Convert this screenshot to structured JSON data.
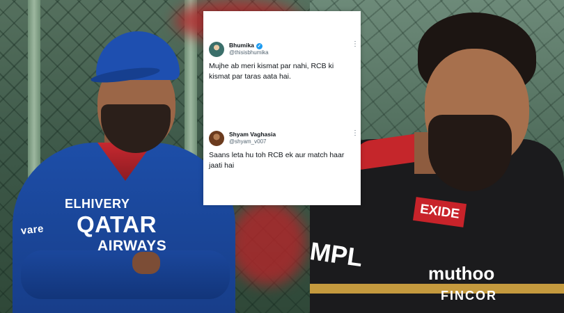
{
  "left_photo": {
    "jersey_sponsor": "ELHIVERY",
    "jersey_main_1": "QATAR",
    "jersey_main_2": "AIRWAYS",
    "sleeve_text": "vare"
  },
  "right_photo": {
    "chest_badge": "EXIDE",
    "sleeve_text": "MPL",
    "sponsor_1": "muthoo",
    "sponsor_2": "FINCOR"
  },
  "tweets": [
    {
      "name": "Bhumika",
      "handle": "@thisisbhumika",
      "verified": true,
      "text": "Mujhe ab meri kismat par nahi, RCB ki kismat par taras aata hai."
    },
    {
      "name": "Shyam Vaghasia",
      "handle": "@shyam_v007",
      "verified": false,
      "text": "Saans leta hu toh RCB ek aur match haar jaati hai"
    }
  ],
  "colors": {
    "verified_badge": "#1d9bf0",
    "rcb_red": "#c8232a",
    "rcb_blue": "#1d4ea8",
    "card_bg": "#ffffff"
  }
}
